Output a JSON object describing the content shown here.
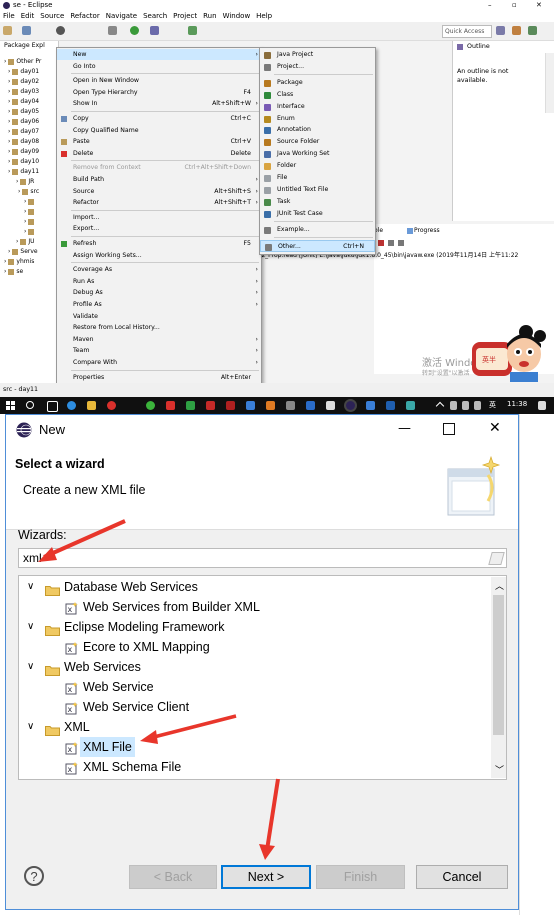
{
  "eclipse": {
    "title": "se - Eclipse",
    "menubar": [
      "File",
      "Edit",
      "Source",
      "Refactor",
      "Navigate",
      "Search",
      "Project",
      "Run",
      "Window",
      "Help"
    ],
    "quick_access": "Quick Access",
    "package_explorer": {
      "tab": "Package Expl",
      "items": [
        "Other Pr",
        "day01",
        "day02",
        "day03",
        "day04",
        "day05",
        "day06",
        "day07",
        "day08",
        "day09",
        "day10",
        "day11",
        "JR",
        "src",
        "",
        "",
        "",
        "",
        "JU",
        "Serve",
        "yhmis",
        "se"
      ]
    },
    "context_menu": [
      {
        "label": "New",
        "shortcut": "",
        "arrow": true,
        "highlight": true
      },
      {
        "label": "Go Into",
        "shortcut": ""
      },
      {
        "sep": true
      },
      {
        "label": "Open in New Window",
        "shortcut": ""
      },
      {
        "label": "Open Type Hierarchy",
        "shortcut": "F4"
      },
      {
        "label": "Show In",
        "shortcut": "Alt+Shift+W",
        "arrow": true
      },
      {
        "sep": true
      },
      {
        "label": "Copy",
        "shortcut": "Ctrl+C"
      },
      {
        "label": "Copy Qualified Name",
        "shortcut": ""
      },
      {
        "label": "Paste",
        "shortcut": "Ctrl+V"
      },
      {
        "label": "Delete",
        "shortcut": "Delete"
      },
      {
        "sep": true
      },
      {
        "label": "Remove from Context",
        "shortcut": "Ctrl+Alt+Shift+Down",
        "disabled": true
      },
      {
        "label": "Build Path",
        "shortcut": "",
        "arrow": true
      },
      {
        "label": "Source",
        "shortcut": "Alt+Shift+S",
        "arrow": true
      },
      {
        "label": "Refactor",
        "shortcut": "Alt+Shift+T",
        "arrow": true
      },
      {
        "sep": true
      },
      {
        "label": "Import...",
        "shortcut": ""
      },
      {
        "label": "Export...",
        "shortcut": ""
      },
      {
        "sep": true
      },
      {
        "label": "Refresh",
        "shortcut": "F5"
      },
      {
        "label": "Assign Working Sets...",
        "shortcut": ""
      },
      {
        "sep": true
      },
      {
        "label": "Coverage As",
        "shortcut": "",
        "arrow": true
      },
      {
        "label": "Run As",
        "shortcut": "",
        "arrow": true
      },
      {
        "label": "Debug As",
        "shortcut": "",
        "arrow": true
      },
      {
        "label": "Profile As",
        "shortcut": "",
        "arrow": true
      },
      {
        "label": "Validate",
        "shortcut": ""
      },
      {
        "label": "Restore from Local History...",
        "shortcut": ""
      },
      {
        "label": "Maven",
        "shortcut": "",
        "arrow": true
      },
      {
        "label": "Team",
        "shortcut": "",
        "arrow": true
      },
      {
        "label": "Compare With",
        "shortcut": "",
        "arrow": true
      },
      {
        "sep": true
      },
      {
        "label": "Properties",
        "shortcut": "Alt+Enter"
      }
    ],
    "new_submenu": [
      {
        "label": "Java Project",
        "color": "#8a6d3b"
      },
      {
        "label": "Project...",
        "color": "#7a7a7a"
      },
      {
        "sep": true
      },
      {
        "label": "Package",
        "color": "#b7791f"
      },
      {
        "label": "Class",
        "color": "#2f8a3b"
      },
      {
        "label": "Interface",
        "color": "#7a5bb5"
      },
      {
        "label": "Enum",
        "color": "#b58a1f"
      },
      {
        "label": "Annotation",
        "color": "#3a6ea8"
      },
      {
        "label": "Source Folder",
        "color": "#b7791f"
      },
      {
        "label": "Java Working Set",
        "color": "#4a6ea8"
      },
      {
        "label": "Folder",
        "color": "#d9a441"
      },
      {
        "label": "File",
        "color": "#9aa0a6"
      },
      {
        "label": "Untitled Text File",
        "color": "#9aa0a6"
      },
      {
        "label": "Task",
        "color": "#4a8a4a"
      },
      {
        "label": "JUnit Test Case",
        "color": "#3a6ea8"
      },
      {
        "sep": true
      },
      {
        "label": "Example...",
        "color": "#7a7a7a"
      },
      {
        "sep": true
      },
      {
        "label": "Other...",
        "shortcut": "Ctrl+N",
        "color": "#7a7a7a",
        "highlight": true
      }
    ],
    "outline": {
      "tab": "Outline",
      "text": "An outline is not available."
    },
    "console": {
      "tab": "ole",
      "progress": "Progress",
      "line": "il2_Prop.read [JUnit] E:\\Java\\jdk8\\jdk1.8.0_45\\bin\\javaw.exe (2019年11月14日 上午11:22"
    },
    "watermark": {
      "line1": "激活 Windo",
      "line2": "转到\"设置\"以激活"
    },
    "status": "src - day11",
    "sticker_text": "英半",
    "taskbar": {
      "ime": "英",
      "time": "11:38"
    }
  },
  "dialog": {
    "title": "New",
    "header_title": "Select a wizard",
    "header_desc": "Create a new XML file",
    "wizards_label": "Wizards:",
    "filter_value": "xml",
    "tree": [
      {
        "label": "Database Web Services",
        "level": 0
      },
      {
        "label": "Web Services from Builder XML",
        "level": 1
      },
      {
        "label": "Eclipse Modeling Framework",
        "level": 0
      },
      {
        "label": "Ecore to XML Mapping",
        "level": 1
      },
      {
        "label": "Web Services",
        "level": 0
      },
      {
        "label": "Web Service",
        "level": 1
      },
      {
        "label": "Web Service Client",
        "level": 1
      },
      {
        "label": "XML",
        "level": 0
      },
      {
        "label": "XML File",
        "level": 1,
        "selected": true
      },
      {
        "label": "XML Schema File",
        "level": 1
      }
    ],
    "buttons": {
      "back": "< Back",
      "next": "Next >",
      "finish": "Finish",
      "cancel": "Cancel"
    },
    "help": "?"
  },
  "colors": {
    "annotation_arrow": "#e8362b",
    "selection": "#cce8ff",
    "accent": "#0078d7"
  }
}
